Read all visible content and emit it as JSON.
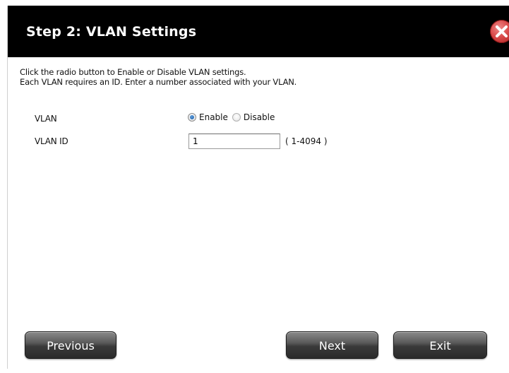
{
  "dialog": {
    "title": "Step 2: VLAN Settings",
    "close_icon": "close-x-icon"
  },
  "instructions": {
    "line1": "Click the radio button to Enable or Disable VLAN settings.",
    "line2": "Each VLAN requires an ID. Enter a number associated with your VLAN."
  },
  "vlan": {
    "label": "VLAN",
    "enable_label": "Enable",
    "disable_label": "Disable",
    "selected": "Enable"
  },
  "vlan_id": {
    "label": "VLAN ID",
    "value": "1",
    "range_hint": "( 1-4094 )"
  },
  "buttons": {
    "previous": "Previous",
    "next": "Next",
    "exit": "Exit"
  },
  "colors": {
    "title_bar": "#000000",
    "close_button": "#d94a4a",
    "button_dark": "#3a3a3a"
  }
}
